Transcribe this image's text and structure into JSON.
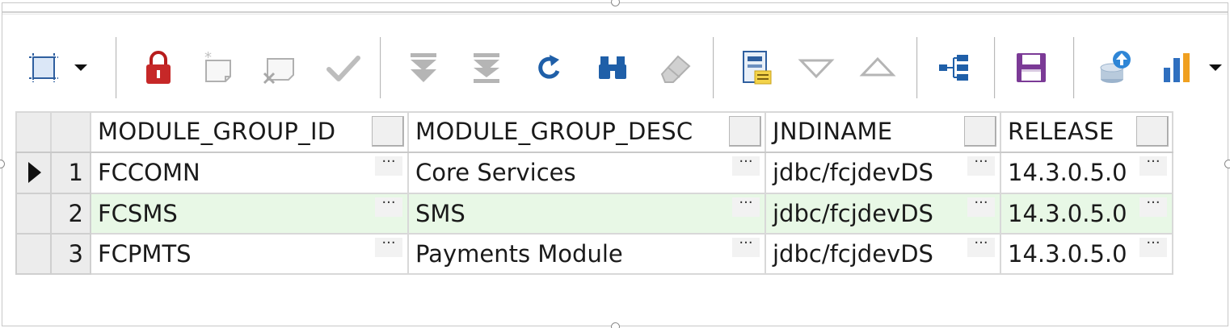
{
  "toolbar": {
    "icons": [
      "select-frame-icon",
      "dropdown-arrow-icon",
      "lock-icon",
      "new-record-icon",
      "delete-record-icon",
      "commit-check-icon",
      "fetch-next-icon",
      "fetch-all-icon",
      "refresh-icon",
      "find-binoculars-icon",
      "clear-eraser-icon",
      "form-view-icon",
      "sort-descending-icon",
      "sort-ascending-icon",
      "tree-view-icon",
      "save-icon",
      "export-database-icon",
      "bar-chart-icon"
    ],
    "colors": {
      "lock": "#c62828",
      "binoculars": "#1f5fa8",
      "refresh": "#1f5fa8",
      "save": "#7b3a96",
      "chart_blue": "#2f6fbf",
      "chart_orange": "#f0a020"
    }
  },
  "grid": {
    "columns": [
      "MODULE_GROUP_ID",
      "MODULE_GROUP_DESC",
      "JNDINAME",
      "RELEASE"
    ],
    "rows": [
      {
        "num": "1",
        "cells": [
          "FCCOMN",
          "Core Services",
          "jdbc/fcjdevDS",
          "14.3.0.5.0"
        ]
      },
      {
        "num": "2",
        "cells": [
          "FCSMS",
          "SMS",
          "jdbc/fcjdevDS",
          "14.3.0.5.0"
        ]
      },
      {
        "num": "3",
        "cells": [
          "FCPMTS",
          "Payments Module",
          "jdbc/fcjdevDS",
          "14.3.0.5.0"
        ]
      }
    ],
    "ellipsis": "···",
    "alt_row_color": "#e8f8e6"
  }
}
